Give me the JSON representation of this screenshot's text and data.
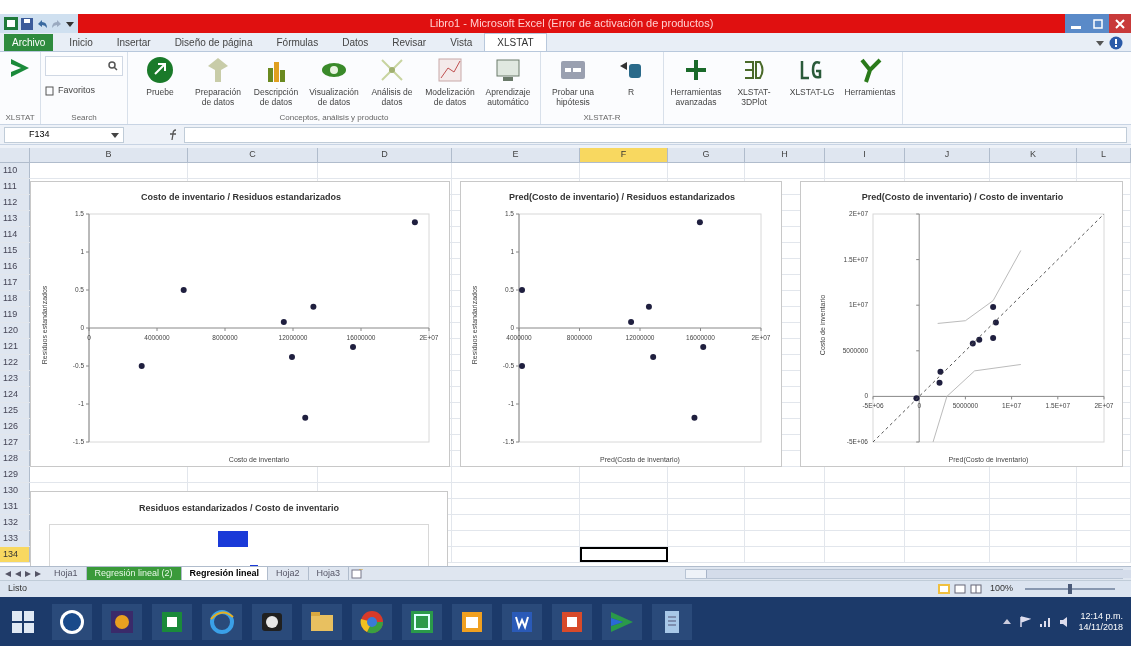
{
  "window": {
    "title": "Libro1 - Microsoft Excel (Error de activación de productos)"
  },
  "ribbon_tabs": [
    {
      "label": "Archivo",
      "selected": false
    },
    {
      "label": "Inicio",
      "selected": false
    },
    {
      "label": "Insertar",
      "selected": false
    },
    {
      "label": "Diseño de página",
      "selected": false
    },
    {
      "label": "Fórmulas",
      "selected": false
    },
    {
      "label": "Datos",
      "selected": false
    },
    {
      "label": "Revisar",
      "selected": false
    },
    {
      "label": "Vista",
      "selected": false
    },
    {
      "label": "XLSTAT",
      "selected": true
    }
  ],
  "ribbon_groups": [
    {
      "kind": "launcher",
      "label": "XLSTAT"
    },
    {
      "kind": "search",
      "label": "Search",
      "favorites": "Favoritos"
    },
    {
      "kind": "buttons",
      "label": "Conceptos, análisis y producto",
      "buttons": [
        "Pruebe",
        "Preparación de datos",
        "Descripción de datos",
        "Visualización de datos",
        "Análisis de datos",
        "Modelización de datos",
        "Aprendizaje automático"
      ]
    },
    {
      "kind": "buttons",
      "label": "XLSTAT-R",
      "buttons": [
        "Probar una hipótesis",
        "R"
      ]
    },
    {
      "kind": "buttons",
      "buttons": [
        "Herramientas avanzadas",
        "XLSTAT-3DPlot",
        "XLSTAT-LG",
        "Herramientas"
      ]
    }
  ],
  "formula_bar": {
    "name_box": "F134"
  },
  "columns": [
    {
      "label": "B",
      "selected": false
    },
    {
      "label": "C",
      "selected": false
    },
    {
      "label": "D",
      "selected": false
    },
    {
      "label": "E",
      "selected": false
    },
    {
      "label": "F",
      "selected": true
    },
    {
      "label": "G",
      "selected": false
    },
    {
      "label": "H",
      "selected": false
    },
    {
      "label": "I",
      "selected": false
    },
    {
      "label": "J",
      "selected": false
    },
    {
      "label": "K",
      "selected": false
    },
    {
      "label": "L",
      "selected": false
    }
  ],
  "rows": [
    {
      "label": "110",
      "selected": false
    },
    {
      "label": "111",
      "selected": false
    },
    {
      "label": "112",
      "selected": false
    },
    {
      "label": "113",
      "selected": false
    },
    {
      "label": "114",
      "selected": false
    },
    {
      "label": "115",
      "selected": false
    },
    {
      "label": "116",
      "selected": false
    },
    {
      "label": "117",
      "selected": false
    },
    {
      "label": "118",
      "selected": false
    },
    {
      "label": "119",
      "selected": false
    },
    {
      "label": "120",
      "selected": false
    },
    {
      "label": "121",
      "selected": false
    },
    {
      "label": "122",
      "selected": false
    },
    {
      "label": "123",
      "selected": false
    },
    {
      "label": "124",
      "selected": false
    },
    {
      "label": "125",
      "selected": false
    },
    {
      "label": "126",
      "selected": false
    },
    {
      "label": "127",
      "selected": false
    },
    {
      "label": "128",
      "selected": false
    },
    {
      "label": "129",
      "selected": false
    },
    {
      "label": "130",
      "selected": false
    },
    {
      "label": "131",
      "selected": false
    },
    {
      "label": "132",
      "selected": false
    },
    {
      "label": "133",
      "selected": false
    },
    {
      "label": "134",
      "selected": true
    }
  ],
  "charts": [
    {
      "chart_data": {
        "type": "scatter",
        "title": "Costo de inventario / Residuos estandarizados",
        "xlabel": "Costo de inventario",
        "ylabel": "Residuos estandarizados",
        "xlim": [
          0,
          20000000
        ],
        "ylim": [
          -1.5,
          1.5
        ],
        "xticks": [
          0,
          4000000,
          8000000,
          12000000,
          16000000,
          {
            "value": 20000000,
            "label": "2E+07"
          }
        ],
        "yticks": [
          -1.5,
          -1,
          -0.5,
          0,
          0.5,
          1,
          1.5
        ],
        "x": [
          3100000,
          5570000,
          11460000,
          13200000,
          11940000,
          12720000,
          15530000,
          19170000
        ],
        "series": [
          {
            "color": "#1f1f3f",
            "values": [
              -0.5,
              0.5,
              0.08,
              0.28,
              -0.38,
              -1.18,
              -0.25,
              1.39
            ]
          }
        ]
      }
    },
    {
      "chart_data": {
        "type": "scatter",
        "title": "Pred(Costo de inventario) / Residuos estandarizados",
        "xlabel": "Pred(Costo de inventario)",
        "ylabel": "Residuos estandarizados",
        "xlim": [
          4000000,
          20000000
        ],
        "ylim": [
          -1.5,
          1.5
        ],
        "xticks": [
          4000000,
          8000000,
          12000000,
          16000000,
          {
            "value": 20000000,
            "label": "2E+07"
          }
        ],
        "yticks": [
          -1.5,
          -1,
          -0.5,
          0,
          0.5,
          1,
          1.5
        ],
        "x": [
          4200000,
          4200000,
          11410000,
          12590000,
          12870000,
          15960000,
          16180000,
          15600000
        ],
        "series": [
          {
            "color": "#1f1f3f",
            "values": [
              -0.5,
              0.5,
              0.08,
              0.28,
              -0.38,
              1.39,
              -0.25,
              -1.18
            ]
          }
        ]
      }
    },
    {
      "chart_data": {
        "type": "scatter",
        "title": "Pred(Costo de inventario) / Costo de inventario",
        "xlabel": "Pred(Costo de inventario)",
        "ylabel": "Costo de inventario",
        "xlim": [
          -5000000,
          20000000
        ],
        "ylim": [
          -5000000,
          20000000
        ],
        "xticks": [
          {
            "value": -5000000,
            "label": "-5E+06"
          },
          0,
          5000000,
          {
            "value": 10000000,
            "label": "1E+07"
          },
          {
            "value": 15000000,
            "label": "1.5E+07"
          },
          {
            "value": 20000000,
            "label": "2E+07"
          }
        ],
        "yticks": [
          {
            "value": -5000000,
            "label": "-5E+06"
          },
          0,
          5000000,
          {
            "value": 10000000,
            "label": "1E+07"
          },
          {
            "value": 15000000,
            "label": "1.5E+07"
          },
          {
            "value": 20000000,
            "label": "2E+07"
          }
        ],
        "x": [
          -300000,
          2200000,
          2300000,
          5800000,
          6500000,
          8000000,
          8000000,
          8300000
        ],
        "series": [
          {
            "color": "#1f1f3f",
            "values": [
              -200000,
              1500000,
              2700000,
              5800000,
              6200000,
              9800000,
              6400000,
              8100000
            ]
          },
          {
            "type": "line",
            "line_style": "dashed",
            "color": "#555555",
            "x": [
              -5000000,
              20000000
            ],
            "values": [
              -5000000,
              20000000
            ]
          },
          {
            "type": "line",
            "line_style": "solid",
            "color": "#bbbbbb",
            "x": [
              2000000,
              5000000,
              8000000,
              11000000
            ],
            "values": [
              8000000,
              8300000,
              10500000,
              16000000
            ]
          },
          {
            "type": "line",
            "line_style": "solid",
            "color": "#bbbbbb",
            "x": [
              1500000,
              3000000,
              6000000,
              11000000
            ],
            "values": [
              -5000000,
              0,
              2800000,
              3500000
            ]
          }
        ]
      }
    },
    {
      "title": "Residuos estandarizados / Costo de inventario"
    }
  ],
  "sheet_tabs": [
    {
      "label": "Hoja1",
      "selected": false
    },
    {
      "label": "Regresión lineal (2)",
      "selected": false,
      "color": "#3a9a3a"
    },
    {
      "label": "Regresión lineal",
      "selected": true
    },
    {
      "label": "Hoja2",
      "selected": false
    },
    {
      "label": "Hoja3",
      "selected": false
    }
  ],
  "status_bar": {
    "text": "Listo",
    "zoom": "100%",
    "zoom_level": {
      "level": 0.5
    }
  },
  "taskbar": {
    "time": "12:14 p.m.",
    "date": "14/11/2018"
  }
}
